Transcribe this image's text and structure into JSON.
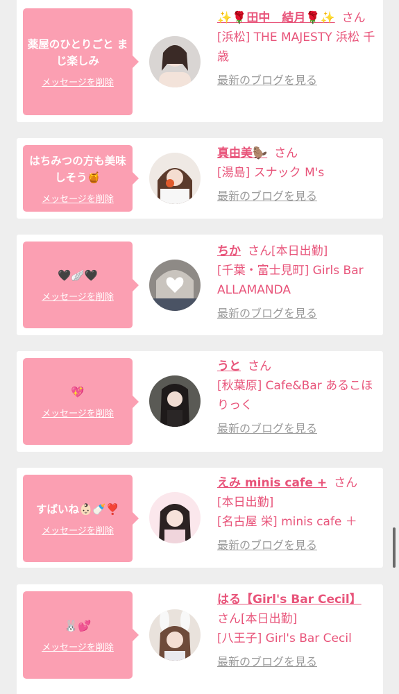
{
  "delete_label": "メッセージを削除",
  "blog_label": "最新のブログを見る",
  "san": "さん",
  "items": [
    {
      "message": "薬屋のひとりごと まじ楽しみ",
      "name": "✨🌹田中　結月🌹✨",
      "status": "",
      "shop": "[浜松] THE MAJESTY 浜松 千歳"
    },
    {
      "message": "はちみつの方も美味しそう🍯",
      "name": "真由美🦫",
      "status": "",
      "shop": "[湯島] スナック M's"
    },
    {
      "message": "🖤🪽🖤",
      "name": "ちか",
      "status": "[本日出勤]",
      "shop": "[千葉・富士見町] Girls Bar ALLAMANDA"
    },
    {
      "message": "💖",
      "name": "うと",
      "status": "",
      "shop": "[秋葉原] Cafe&Bar あるこほりっく"
    },
    {
      "message": "すばいね👶🏻🍼❣️",
      "name": "えみ minis cafe +",
      "status": "[本日出勤]",
      "shop": "[名古屋 栄] minis cafe ＋"
    },
    {
      "message": "🐰💕",
      "name": "はる【Girl's Bar Cecil】",
      "status": "[本日出勤]",
      "shop": "[八王子] Girl's Bar Cecil"
    }
  ]
}
